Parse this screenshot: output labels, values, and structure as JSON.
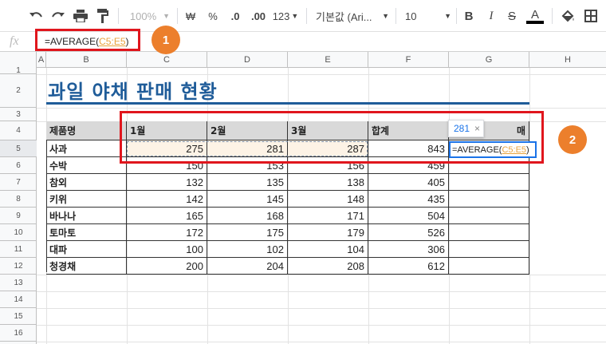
{
  "toolbar": {
    "zoom": "100%",
    "currency": "₩",
    "percent": "%",
    "dec_decrease": ".0",
    "dec_increase": ".00",
    "more_formats": "123",
    "font_family": "기본값 (Ari...",
    "font_size": "10",
    "bold": "B",
    "italic": "I",
    "strike": "S",
    "text_color": "A",
    "icons": [
      "undo-icon",
      "redo-icon",
      "print-icon",
      "paint-format-icon",
      "fill-color-icon",
      "borders-icon"
    ]
  },
  "formula_bar": {
    "fx_label": "fx",
    "prefix": "=AVERAGE(",
    "ref": "C5:E5",
    "suffix": ")"
  },
  "columns": [
    "A",
    "B",
    "C",
    "D",
    "E",
    "F",
    "G",
    "H"
  ],
  "rows": [
    "1",
    "2",
    "3",
    "4",
    "5",
    "6",
    "7",
    "8",
    "9",
    "10",
    "11",
    "12",
    "13",
    "14",
    "15",
    "16"
  ],
  "sheet": {
    "title": "과일 야채 판매 현황",
    "headers": [
      "제품명",
      "1월",
      "2월",
      "3월",
      "합계",
      "평균"
    ],
    "data": [
      [
        "사과",
        "275",
        "281",
        "287",
        "843",
        ""
      ],
      [
        "수박",
        "150",
        "153",
        "156",
        "459",
        ""
      ],
      [
        "참외",
        "132",
        "135",
        "138",
        "405",
        ""
      ],
      [
        "키위",
        "142",
        "145",
        "148",
        "435",
        ""
      ],
      [
        "바나나",
        "165",
        "168",
        "171",
        "504",
        ""
      ],
      [
        "토마토",
        "172",
        "175",
        "179",
        "526",
        ""
      ],
      [
        "대파",
        "100",
        "102",
        "104",
        "306",
        ""
      ],
      [
        "청경채",
        "200",
        "204",
        "208",
        "612",
        ""
      ]
    ],
    "header_avg_visible": "매",
    "editing": {
      "prefix": "=AVERAGE(",
      "ref": "C5:E5",
      "suffix": ")",
      "preview_value": "281",
      "preview_close": "×"
    }
  },
  "annotations": {
    "badge1": "1",
    "badge2": "2"
  },
  "colors": {
    "title": "#1f5c99",
    "header_fill": "#d9d9d9",
    "highlight_fill": "#fdf3e6",
    "annotation_red": "#e0161d",
    "badge_orange": "#ec7f2c",
    "selection_blue": "#1a73e8",
    "reference_orange": "#e8a33d"
  }
}
